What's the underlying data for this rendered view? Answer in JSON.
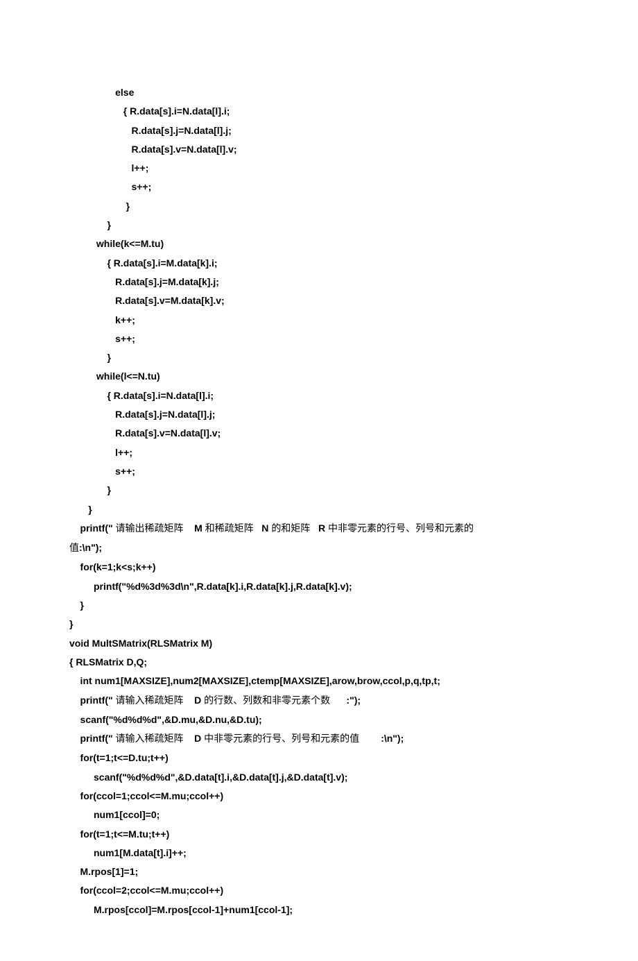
{
  "code": {
    "l1": "                 else",
    "l2": "                    { R.data[s].i=N.data[l].i;",
    "l3": "                       R.data[s].j=N.data[l].j;",
    "l4": "                       R.data[s].v=N.data[l].v;",
    "l5": "                       l++;",
    "l6": "                       s++;",
    "l7": "                     }",
    "l8": "              }",
    "l9": "          while(k<=M.tu)",
    "l10": "              { R.data[s].i=M.data[k].i;",
    "l11": "                 R.data[s].j=M.data[k].j;",
    "l12": "                 R.data[s].v=M.data[k].v;",
    "l13": "                 k++;",
    "l14": "                 s++;",
    "l15": "              }",
    "l16": "          while(l<=N.tu)",
    "l17": "              { R.data[s].i=N.data[l].i;",
    "l18": "                 R.data[s].j=N.data[l].j;",
    "l19": "                 R.data[s].v=N.data[l].v;",
    "l20": "                 l++;",
    "l21": "                 s++;",
    "l22": "              }",
    "l23": "       }",
    "l24a": "    printf(\" ",
    "l24b": "请输出稀疏矩阵",
    "l24c": "    M ",
    "l24d": "和稀疏矩阵",
    "l24e": "   N ",
    "l24f": "的和矩阵",
    "l24g": "   R ",
    "l24h": "中非零元素的行号、列号和元素的",
    "l25a": "值",
    "l25b": ":\\n\");",
    "l26": "    for(k=1;k<s;k++)",
    "l27": "         printf(\"%d%3d%3d\\n\",R.data[k].i,R.data[k].j,R.data[k].v);",
    "l28": "    }",
    "l29": "}",
    "l30": "void MultSMatrix(RLSMatrix M)",
    "l31": "{ RLSMatrix D,Q;",
    "l32": "    int num1[MAXSIZE],num2[MAXSIZE],ctemp[MAXSIZE],arow,brow,ccol,p,q,tp,t;",
    "l33a": "    printf(\" ",
    "l33b": "请输入稀疏矩阵",
    "l33c": "    D ",
    "l33d": "的行数、列数和非零元素个数",
    "l33e": "      :\");",
    "l34": "    scanf(\"%d%d%d\",&D.mu,&D.nu,&D.tu);",
    "l35a": "    printf(\" ",
    "l35b": "请输入稀疏矩阵",
    "l35c": "    D ",
    "l35d": "中非零元素的行号、列号和元素的值",
    "l35e": "        :\\n\");",
    "l36": "    for(t=1;t<=D.tu;t++)",
    "l37": "         scanf(\"%d%d%d\",&D.data[t].i,&D.data[t].j,&D.data[t].v);",
    "l38": "    for(ccol=1;ccol<=M.mu;ccol++)",
    "l39": "         num1[ccol]=0;",
    "l40": "    for(t=1;t<=M.tu;t++)",
    "l41": "         num1[M.data[t].i]++;",
    "l42": "    M.rpos[1]=1;",
    "l43": "    for(ccol=2;ccol<=M.mu;ccol++)",
    "l44": "         M.rpos[ccol]=M.rpos[ccol-1]+num1[ccol-1];"
  }
}
